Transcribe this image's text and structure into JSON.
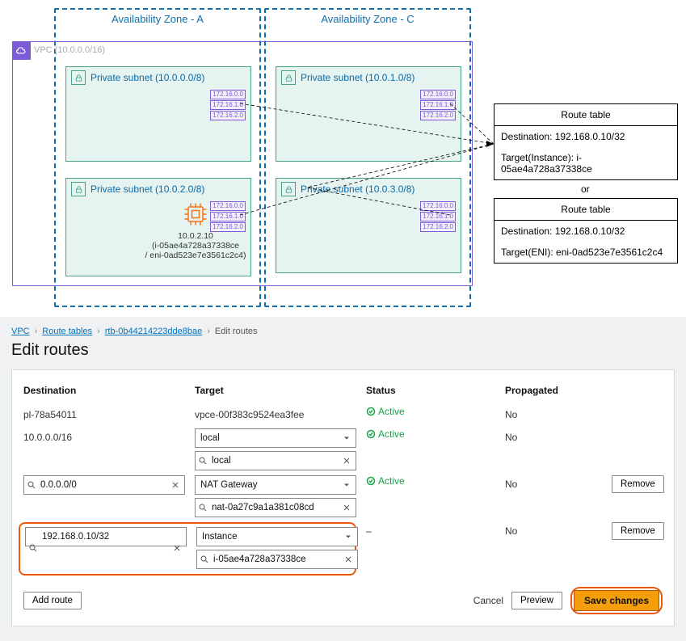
{
  "diagram": {
    "az_a": "Availability Zone - A",
    "az_c": "Availability Zone - C",
    "vpc_label": "VPC (10.0.0.0/16)",
    "subnets": {
      "a1": "Private subnet (10.0.0.0/8)",
      "c1": "Private subnet (10.0.1.0/8)",
      "a2": "Private subnet (10.0.2.0/8)",
      "c2": "Private subnet (10.0.3.0/8)"
    },
    "rtb_chips": [
      "172.16.0.0",
      "172.16.1.0",
      "172.16.2.0"
    ],
    "instance": {
      "ip": "10.0.2.10",
      "id_line": "(i-05ae4a728a37338ce",
      "eni_line": "/ eni-0ad523e7e3561c2c4)"
    },
    "route_table_1": {
      "title": "Route table",
      "dest": "Destination: 192.168.0.10/32",
      "target": "Target(Instance): i-05ae4a728a37338ce"
    },
    "or": "or",
    "route_table_2": {
      "title": "Route table",
      "dest": "Destination: 192.168.0.10/32",
      "target": "Target(ENI): eni-0ad523e7e3561c2c4"
    }
  },
  "console": {
    "crumbs": {
      "vpc": "VPC",
      "rt": "Route tables",
      "id": "rtb-0b44214223dde8bae",
      "page": "Edit routes"
    },
    "h1": "Edit routes",
    "headers": {
      "dest": "Destination",
      "target": "Target",
      "status": "Status",
      "prop": "Propagated"
    },
    "rows": [
      {
        "dest_static": "pl-78a54011",
        "target_static": "vpce-00f383c9524ea3fee",
        "status": "Active",
        "prop": "No"
      },
      {
        "dest_static": "10.0.0.0/16",
        "target_sel": "local",
        "target_search": "local",
        "status": "Active",
        "prop": "No"
      },
      {
        "dest_search": "0.0.0.0/0",
        "target_sel": "NAT Gateway",
        "target_search": "nat-0a27c9a1a381c08cd",
        "status": "Active",
        "prop": "No",
        "remove": "Remove"
      },
      {
        "dest_search": "192.168.0.10/32",
        "target_sel": "Instance",
        "target_search": "i-05ae4a728a37338ce",
        "status": "–",
        "prop": "No",
        "remove": "Remove",
        "highlight": true
      }
    ],
    "add_route": "Add route",
    "cancel": "Cancel",
    "preview": "Preview",
    "save": "Save changes"
  }
}
